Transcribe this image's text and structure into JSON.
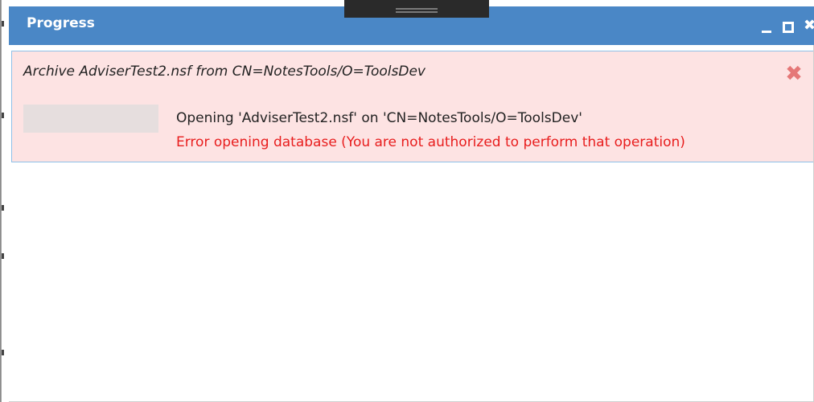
{
  "window": {
    "title": "Progress"
  },
  "task": {
    "title": "Archive AdviserTest2.nsf from CN=NotesTools/O=ToolsDev",
    "status": "Opening 'AdviserTest2.nsf' on 'CN=NotesTools/O=ToolsDev'",
    "error": "Error opening database (You are not authorized to perform that operation)",
    "progress_fraction": 0
  },
  "icons": {
    "minimize": "minimize-icon",
    "maximize": "maximize-icon",
    "close": "close-icon",
    "dismiss": "dismiss-x-icon"
  },
  "colors": {
    "titlebar": "#4a87c6",
    "card_background": "#fde3e3",
    "error_text": "#e81d1d",
    "dismiss": "#e57777"
  }
}
